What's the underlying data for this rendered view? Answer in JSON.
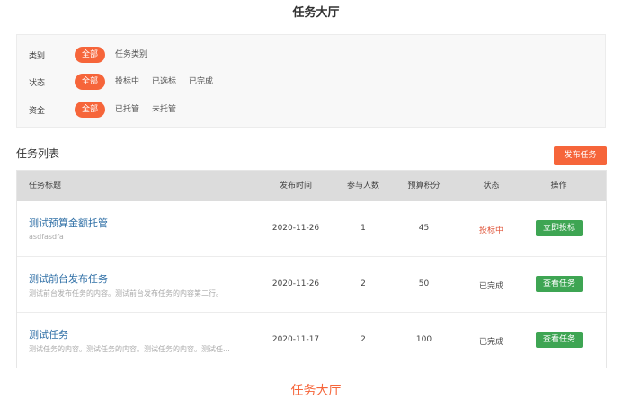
{
  "page_title": "任务大厅",
  "filters": [
    {
      "label": "类别",
      "options": [
        "全部",
        "任务类别"
      ],
      "active": 0
    },
    {
      "label": "状态",
      "options": [
        "全部",
        "投标中",
        "已选标",
        "已完成"
      ],
      "active": 0
    },
    {
      "label": "资金",
      "options": [
        "全部",
        "已托管",
        "未托管"
      ],
      "active": 0
    }
  ],
  "list_title": "任务列表",
  "publish_button": "发布任务",
  "table": {
    "headers": [
      "任务标题",
      "发布时间",
      "参与人数",
      "预算积分",
      "状态",
      "操作"
    ],
    "rows": [
      {
        "title": "测试预算金额托管",
        "desc": "asdfasdfa",
        "date": "2020-11-26",
        "participants": "1",
        "budget": "45",
        "status": "投标中",
        "action": "立即投标"
      },
      {
        "title": "测试前台发布任务",
        "desc": "测试前台发布任务的内容。测试前台发布任务的内容第二行。",
        "date": "2020-11-26",
        "participants": "2",
        "budget": "50",
        "status": "已完成",
        "action": "查看任务"
      },
      {
        "title": "测试任务",
        "desc": "测试任务的内容。测试任务的内容。测试任务的内容。测试任...",
        "date": "2020-11-17",
        "participants": "2",
        "budget": "100",
        "status": "已完成",
        "action": "查看任务"
      }
    ]
  },
  "footer_caption": "任务大厅",
  "colors": {
    "accent": "#f6653a",
    "action_green": "#3ea553",
    "link_blue": "#2f6fa6",
    "bidding_red": "#e0553a"
  }
}
